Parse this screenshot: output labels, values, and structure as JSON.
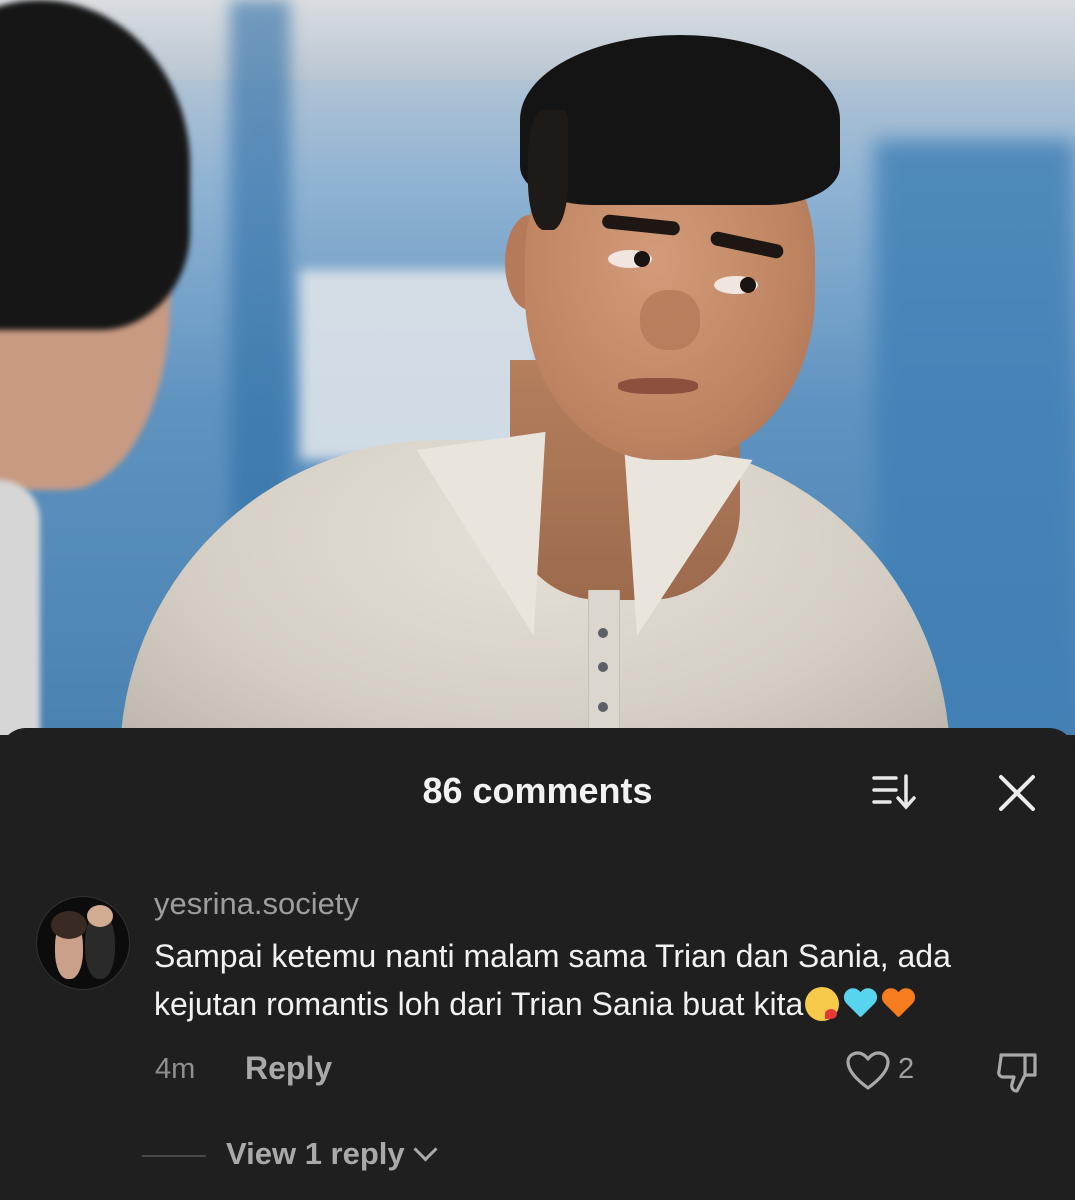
{
  "video": {
    "description_icon": "video-frame"
  },
  "comments_sheet": {
    "title": "86 comments",
    "sort_icon": "sort-icon",
    "close_icon": "close-icon"
  },
  "comment": {
    "username": "yesrina.society",
    "text": "Sampai ketemu nanti malam sama Trian dan Sania, ada kejutan romantis loh dari Trian Sania buat kita",
    "emojis": [
      "kissing-face-emoji",
      "light-blue-heart-emoji",
      "orange-heart-emoji"
    ],
    "time": "4m",
    "reply_label": "Reply",
    "like_count": "2",
    "like_icon": "heart-icon",
    "dislike_icon": "thumbs-down-icon"
  },
  "replies": {
    "view_label": "View 1 reply"
  }
}
